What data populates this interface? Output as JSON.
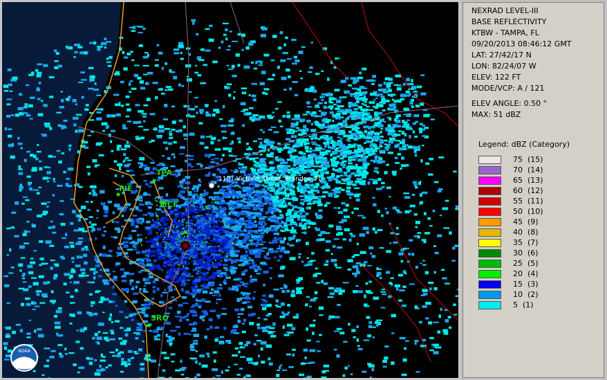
{
  "info": {
    "product": "NEXRAD LEVEL-III",
    "type": "BASE REFLECTIVITY",
    "station": "KTBW - TAMPA, FL",
    "datetime": "09/20/2013 08:46:12 GMT",
    "lat": "LAT: 27/42/17 N",
    "lon": "LON: 82/24/07 W",
    "elev": "ELEV: 122 FT",
    "mode": "MODE/VCP: A / 121",
    "elev_angle": "ELEV ANGLE: 0.50 °",
    "max": "MAX: 51 dBZ"
  },
  "legend": {
    "title": "Legend: dBZ (Category)",
    "items": [
      {
        "label": "75  (15)",
        "color": "#e8e8e8"
      },
      {
        "label": "70  (14)",
        "color": "#9966cc"
      },
      {
        "label": "65  (13)",
        "color": "#ff00ff"
      },
      {
        "label": "60  (12)",
        "color": "#b00000"
      },
      {
        "label": "55  (11)",
        "color": "#d40000"
      },
      {
        "label": "50  (10)",
        "color": "#ff0000"
      },
      {
        "label": "45  (9)",
        "color": "#ff9900"
      },
      {
        "label": "40  (8)",
        "color": "#e6b800"
      },
      {
        "label": "35  (7)",
        "color": "#ffff00"
      },
      {
        "label": "30  (6)",
        "color": "#008800"
      },
      {
        "label": "25  (5)",
        "color": "#00bb00"
      },
      {
        "label": "20  (4)",
        "color": "#00ee00"
      },
      {
        "label": "15  (3)",
        "color": "#0000ee"
      },
      {
        "label": "10  (2)",
        "color": "#0099ee"
      },
      {
        "label": "5  (1)",
        "color": "#00eeee"
      }
    ]
  },
  "map": {
    "airports": [
      "TPA",
      "PIE",
      "MCF",
      "SRQ"
    ],
    "location_label": "1101 Victoria Street, Brandon, FL",
    "logo": "NOAA"
  }
}
